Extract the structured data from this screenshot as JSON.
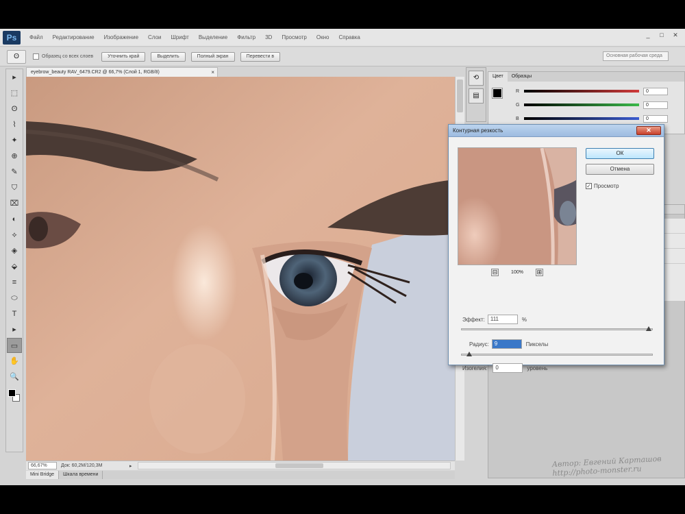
{
  "app": {
    "logo": "Ps",
    "menu": [
      "Файл",
      "Редактирование",
      "Изображение",
      "Слои",
      "Шрифт",
      "Выделение",
      "Фильтр",
      "3D",
      "Просмотр",
      "Окно",
      "Справка"
    ],
    "window_controls": [
      "_",
      "□",
      "✕"
    ]
  },
  "options_bar": {
    "tool_icon": "lasso-icon",
    "sample_all_layers_label": "Образец со всех слоев",
    "buttons": [
      "Уточнить край",
      "Выделить",
      "Полный экран",
      "Перевести в"
    ],
    "workspace_placeholder": "Основная рабочая среда"
  },
  "document": {
    "tab_title": "eyebrow_beauty  RAV_6479.CR2 @ 66,7% (Слой 1, RGB/8)",
    "close": "×",
    "zoom": "66,67%",
    "doc_size": "Док: 60,2M/120,3M",
    "arrow": "▸"
  },
  "bottom_tabs": [
    "Mini Bridge",
    "Шкала времени"
  ],
  "tools": [
    "▸",
    "⬚",
    "ʘ",
    "⌇",
    "✦",
    "⊕",
    "✎",
    "⛉",
    "⌧",
    "◐",
    "⟡",
    "◈",
    "⬙",
    "≡",
    "⬭",
    "T",
    "▸",
    "▭",
    "✋",
    "🔍"
  ],
  "color_panel": {
    "tabs": [
      "Цвет",
      "Образцы"
    ],
    "channels": [
      {
        "name": "R",
        "value": "0",
        "color": "#d03a3a"
      },
      {
        "name": "G",
        "value": "0",
        "color": "#3ab94a"
      },
      {
        "name": "B",
        "value": "0",
        "color": "#3a5bd0"
      }
    ]
  },
  "dialog": {
    "title": "Контурная резкость",
    "ok": "ОК",
    "cancel": "Отмена",
    "preview_label": "Просмотр",
    "preview_checked": "✓",
    "zoom_level": "100%",
    "zoom_out": "⊟",
    "zoom_in": "⊞",
    "effect_label": "Эффект:",
    "effect_value": "111",
    "effect_unit": "%",
    "radius_label": "Радиус:",
    "radius_value": "9",
    "radius_unit": "Пикселы",
    "threshold_label": "Изогелия:",
    "threshold_value": "0",
    "threshold_unit": "уровень"
  },
  "sliders": {
    "effect_fraction": 0.998,
    "radius_fraction": 0.025,
    "threshold_fraction": 0.0
  },
  "watermark": {
    "line1": "Автор: Евгений Карташов",
    "line2": "http://photo-monster.ru"
  },
  "colors": {
    "skin": "#d8ac93",
    "ok_button": "#bde6fd",
    "dialog_title": "#9dbbe0",
    "close_button": "#c7402b"
  }
}
